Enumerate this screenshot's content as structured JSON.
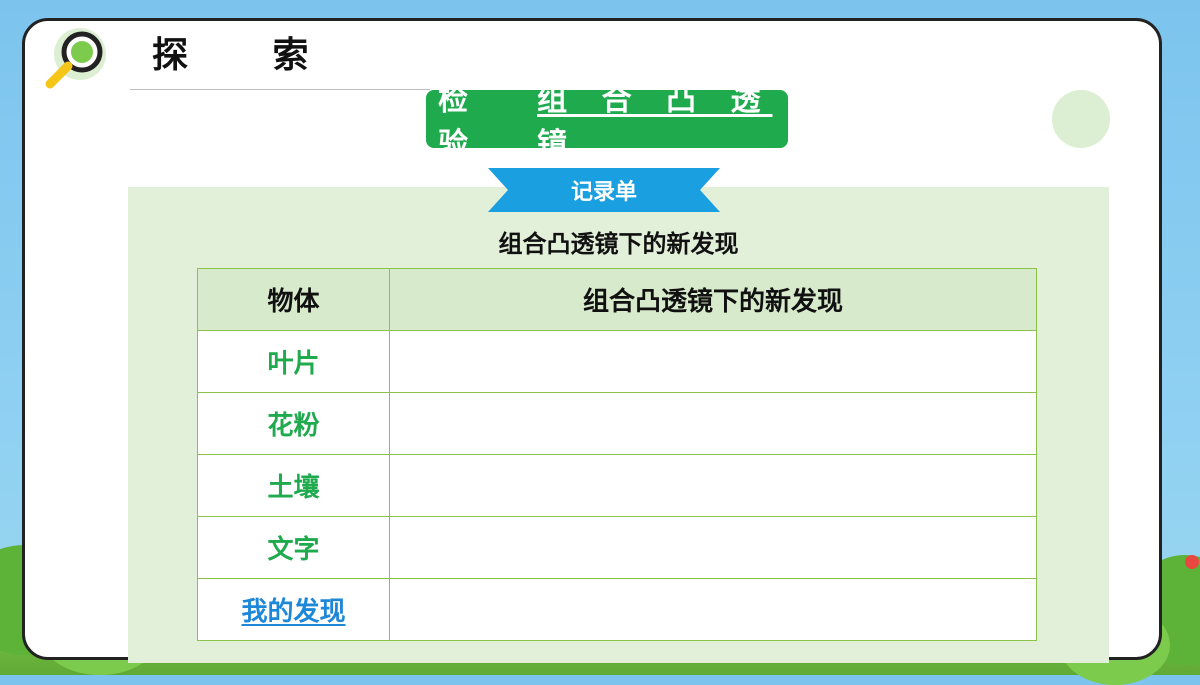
{
  "header": {
    "title": "探 索"
  },
  "topic": {
    "part1": "检 验",
    "part2": "组 合 凸 透 镜"
  },
  "ribbon": {
    "label": "记录单"
  },
  "subtitle": "组合凸透镜下的新发现",
  "table": {
    "headers": [
      "物体",
      "组合凸透镜下的新发现"
    ],
    "rows": [
      {
        "object": "叶片",
        "finding": ""
      },
      {
        "object": "花粉",
        "finding": ""
      },
      {
        "object": "土壤",
        "finding": ""
      },
      {
        "object": "文字",
        "finding": ""
      },
      {
        "object": "我的发现",
        "finding": ""
      }
    ]
  },
  "colors": {
    "accent_green": "#1faa4e",
    "ribbon_blue": "#1a9fe0",
    "link_blue": "#1e88d8",
    "panel_bg": "#e2efd9"
  },
  "icons": [
    "magnifier-icon"
  ]
}
